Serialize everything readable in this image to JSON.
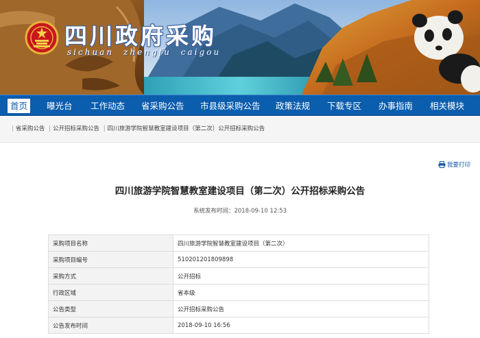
{
  "banner": {
    "title": "四川政府采购",
    "subtitle": [
      "sichuan",
      "zhengfu",
      "caigou"
    ]
  },
  "nav": {
    "items": [
      {
        "label": "首页",
        "active": true
      },
      {
        "label": "曝光台"
      },
      {
        "label": "工作动态"
      },
      {
        "label": "省采购公告"
      },
      {
        "label": "市县级采购公告"
      },
      {
        "label": "政策法规"
      },
      {
        "label": "下载专区"
      },
      {
        "label": "办事指南"
      },
      {
        "label": "相关模块"
      }
    ]
  },
  "breadcrumb": {
    "items": [
      "省采购公告",
      "公开招标采购公告",
      "四川旅游学院智慧教室建设项目（第二次）公开招标采购公告"
    ]
  },
  "article": {
    "print_label": "我要打印",
    "title": "四川旅游学院智慧教室建设项目（第二次）公开招标采购公告",
    "publish_time": "系统发布时间：2018-09-10 12:53",
    "rows": [
      {
        "key": "采购项目名称",
        "value": "四川旅游学院智慧教室建设项目（第二次）"
      },
      {
        "key": "采购项目编号",
        "value": "510201201809898"
      },
      {
        "key": "采购方式",
        "value": "公开招标"
      },
      {
        "key": "行政区域",
        "value": "省本级"
      },
      {
        "key": "公告类型",
        "value": "公开招标采购公告"
      },
      {
        "key": "公告发布时间",
        "value": "2018-09-10 16:56"
      }
    ]
  },
  "colors": {
    "nav_bg": "#0b5dae",
    "link": "#1a5ba8"
  }
}
